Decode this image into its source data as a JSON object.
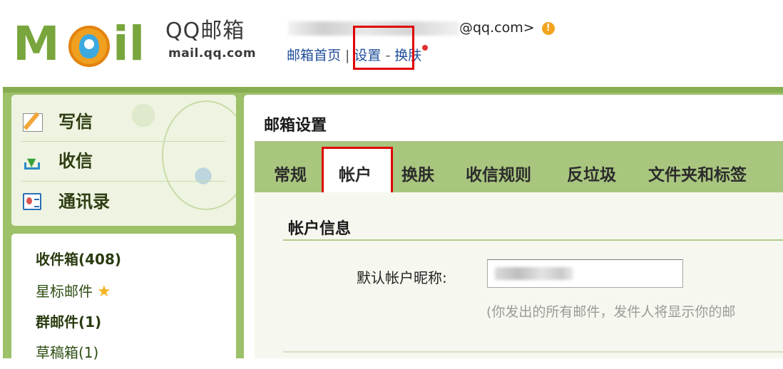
{
  "logo": {
    "mark": "MOil",
    "product": "QQ邮箱",
    "domain": "mail.qq.com"
  },
  "header": {
    "account_visible": "@qq.com>",
    "warning_icon": "warning-icon",
    "links": {
      "home": "邮箱首页",
      "sep1": "|",
      "settings": "设置",
      "sep2": "-",
      "skin": "换肤"
    }
  },
  "sidebar": {
    "actions": [
      {
        "label": "写信",
        "icon": "pencil-icon"
      },
      {
        "label": "收信",
        "icon": "inbox-download-icon"
      },
      {
        "label": "通讯录",
        "icon": "contact-card-icon"
      }
    ],
    "folders": [
      {
        "label": "收件箱(408)",
        "bold": true
      },
      {
        "label": "星标邮件",
        "bold": false,
        "icon": "star-icon"
      },
      {
        "label": "群邮件(1)",
        "bold": true
      },
      {
        "label": "草稿箱(1)",
        "bold": false
      }
    ]
  },
  "main": {
    "title": "邮箱设置",
    "tabs": [
      "常规",
      "帐户",
      "换肤",
      "收信规则",
      "反垃圾",
      "文件夹和标签"
    ],
    "active_tab": "帐户",
    "section": {
      "title": "帐户信息",
      "field_label": "默认帐户昵称:",
      "field_note": "(你发出的所有邮件，发件人将显示你的邮"
    }
  },
  "colors": {
    "brand_green": "#78a53c",
    "frame_green": "#9cc169",
    "tab_bar": "#a9c67f",
    "link_blue": "#1f4e9a",
    "highlight_red": "#e00000"
  }
}
